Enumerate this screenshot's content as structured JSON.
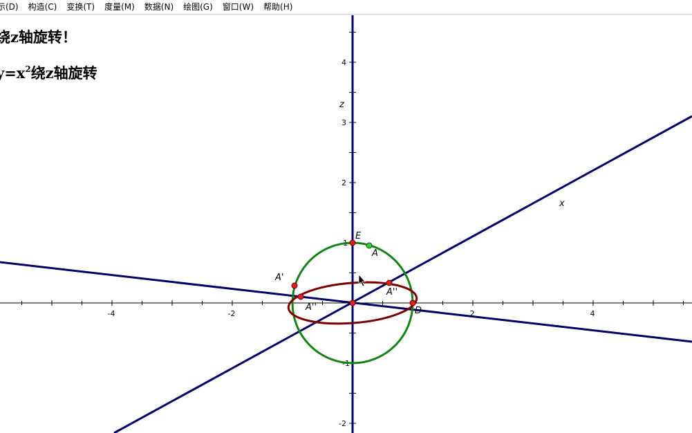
{
  "menu": {
    "items": [
      {
        "label": "示(D)"
      },
      {
        "label": "构造(C)"
      },
      {
        "label": "变换(T)"
      },
      {
        "label": "度量(M)"
      },
      {
        "label": "数据(N)"
      },
      {
        "label": "绘图(G)"
      },
      {
        "label": "窗口(W)"
      },
      {
        "label": "帮助(H)"
      }
    ]
  },
  "sketch": {
    "caption_1": "绕z轴旋转！",
    "caption_2_prefix": "y=x",
    "caption_2_sup": "2",
    "caption_2_suffix": "绕z轴旋转"
  },
  "axes": {
    "z_label": "z",
    "x_label": "x",
    "tick_labels_x": [
      "-4",
      "-2",
      "2",
      "4"
    ],
    "tick_labels_z": [
      "4",
      "3",
      "2",
      "1",
      "-1",
      "-2"
    ]
  },
  "points": {
    "E": "E",
    "A": "A",
    "A1": "A'",
    "A2": "A''",
    "A3": "A''",
    "D": "D"
  },
  "colors": {
    "axis": "#000066",
    "circle": "#148214",
    "ellipse": "#7a0000",
    "point_red": "#e02020",
    "point_green": "#3cc83c"
  }
}
